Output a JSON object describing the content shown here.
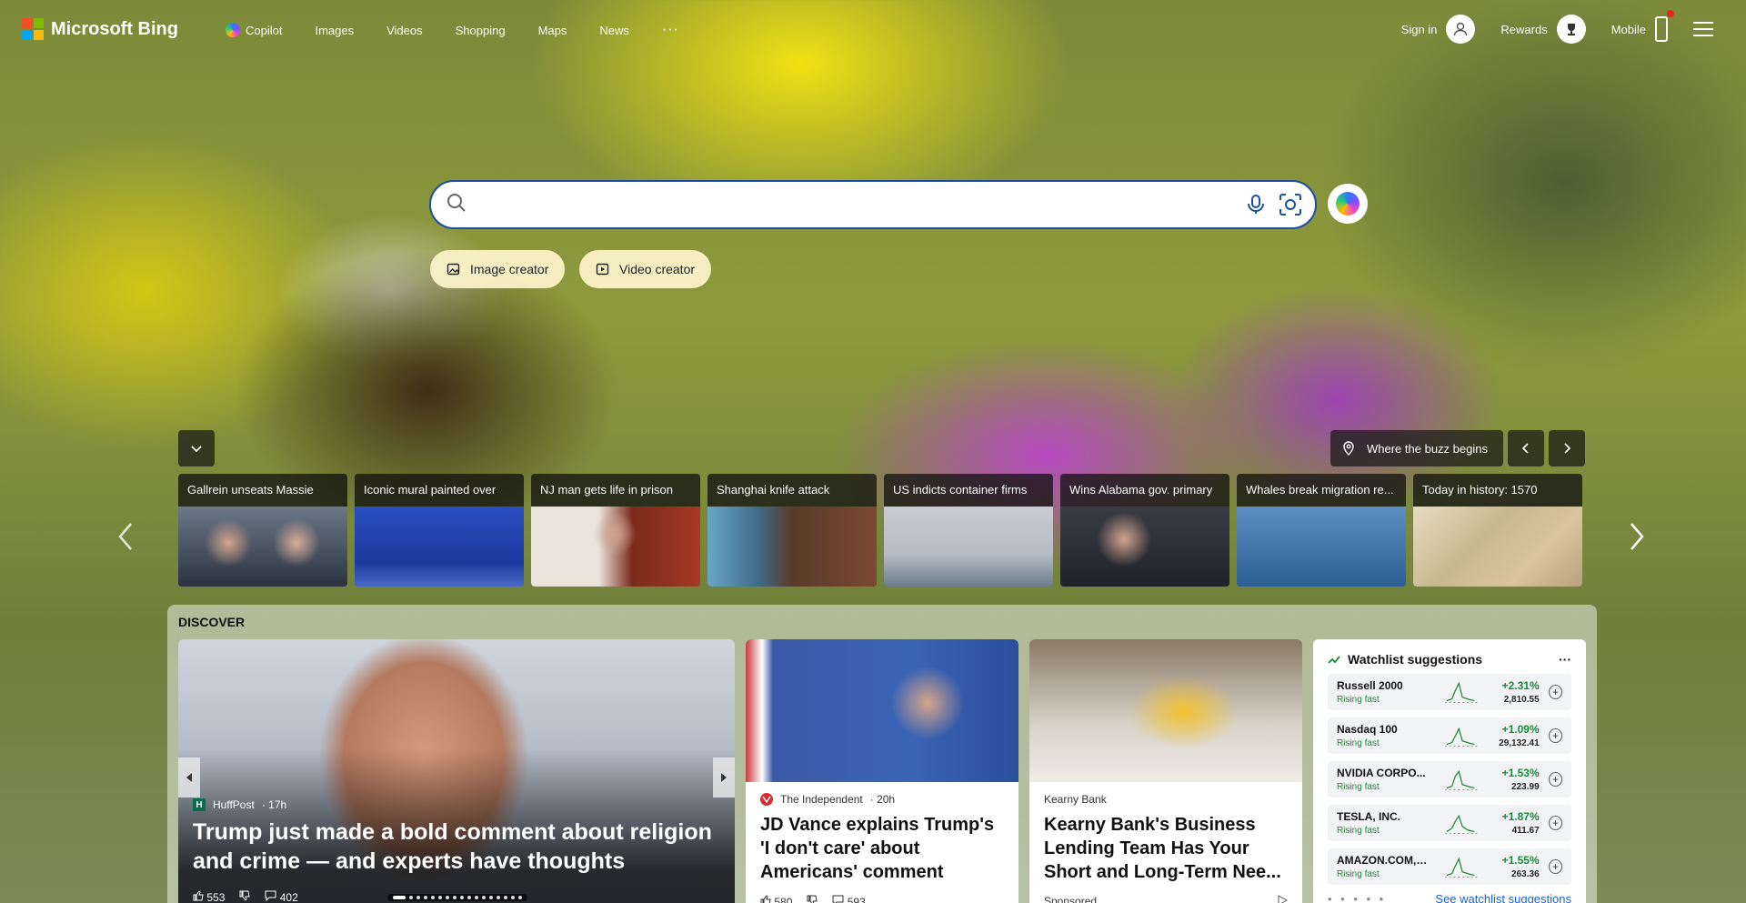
{
  "brand": {
    "name": "Microsoft Bing"
  },
  "nav": {
    "items": [
      {
        "label": "Copilot"
      },
      {
        "label": "Images"
      },
      {
        "label": "Videos"
      },
      {
        "label": "Shopping"
      },
      {
        "label": "Maps"
      },
      {
        "label": "News"
      }
    ],
    "more": "···"
  },
  "account": {
    "sign_in": "Sign in",
    "rewards": "Rewards",
    "mobile": "Mobile"
  },
  "search": {
    "placeholder": ""
  },
  "quick_actions": {
    "image_creator": "Image creator",
    "video_creator": "Video creator"
  },
  "background": {
    "location_label": "Where the buzz begins"
  },
  "trending": [
    {
      "title": "Gallrein unseats Massie"
    },
    {
      "title": "Iconic mural painted over"
    },
    {
      "title": "NJ man gets life in prison"
    },
    {
      "title": "Shanghai knife attack"
    },
    {
      "title": "US indicts container firms"
    },
    {
      "title": "Wins Alabama gov. primary"
    },
    {
      "title": "Whales break migration re..."
    },
    {
      "title": "Today in history: 1570"
    }
  ],
  "discover": {
    "title": "DISCOVER",
    "hero": {
      "source": "HuffPost",
      "age": "· 17h",
      "headline": "Trump just made a bold comment about religion and crime — and experts have thoughts",
      "likes": "553",
      "comments": "402"
    },
    "article1": {
      "source": "The Independent",
      "age": "· 20h",
      "headline": "JD Vance explains Trump's 'I don't care' about Americans' comment",
      "likes": "580",
      "comments": "593"
    },
    "article2": {
      "source": "Kearny Bank",
      "headline": "Kearny Bank's Business Lending Team Has Your Short and Long-Term Nee...",
      "sponsored": "Sponsored"
    }
  },
  "watchlist": {
    "title": "Watchlist suggestions",
    "more": "···",
    "rows": [
      {
        "name": "Russell 2000",
        "status": "Rising fast",
        "change": "+2.31%",
        "price": "2,810.55"
      },
      {
        "name": "Nasdaq 100",
        "status": "Rising fast",
        "change": "+1.09%",
        "price": "29,132.41"
      },
      {
        "name": "NVIDIA CORPO...",
        "status": "Rising fast",
        "change": "+1.53%",
        "price": "223.99"
      },
      {
        "name": "TESLA, INC.",
        "status": "Rising fast",
        "change": "+1.87%",
        "price": "411.67"
      },
      {
        "name": "AMAZON.COM, I...",
        "status": "Rising fast",
        "change": "+1.55%",
        "price": "263.36"
      }
    ],
    "see_more": "See watchlist suggestions"
  },
  "colors": {
    "accent": "#1a4fa3",
    "rising": "#1a8a3a",
    "link": "#1a62d6"
  }
}
